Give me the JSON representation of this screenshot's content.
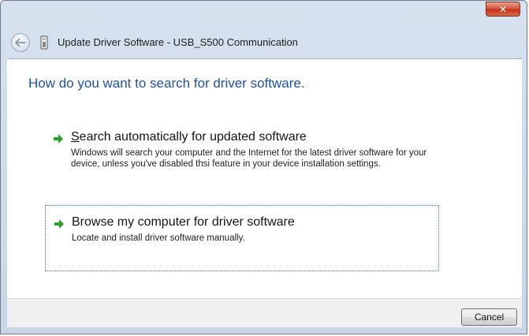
{
  "window": {
    "title": "Update Driver Software - USB_S500 Communication",
    "close_label": "✕"
  },
  "content": {
    "heading": "How do you want to search for driver software.",
    "options": [
      {
        "accel_char": "S",
        "title_rest": "earch automatically for updated software",
        "description": "Windows will search your computer and the Internet for the latest driver software for your device, unless you've disabled thsi feature in your device installation settings."
      },
      {
        "title": "Browse my computer for driver software",
        "description": "Locate and install driver software manually."
      }
    ]
  },
  "footer": {
    "cancel_label": "Cancel"
  },
  "icons": {
    "back": "back-arrow-icon",
    "device": "usb-device-icon",
    "option_arrow": "green-arrow-icon"
  },
  "colors": {
    "heading": "#1f51a5",
    "arrow": "#2f9e2a",
    "close": "#c7311c"
  }
}
